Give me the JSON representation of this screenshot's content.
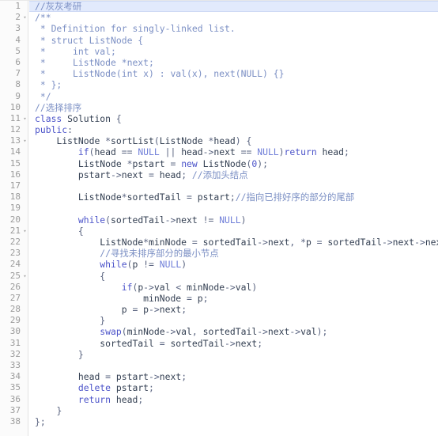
{
  "editor": {
    "name": "code-editor",
    "language": "cpp",
    "active_line": 1,
    "total_lines": 38,
    "colors": {
      "background": "#ffffff",
      "gutter_background": "#fbfbfb",
      "gutter_border": "#e3e3e3",
      "line_number": "#9a9a9a",
      "active_line_background": "#e2eafc",
      "active_line_border": "#cdd9f5",
      "plain_text": "#333f52",
      "comment": "#7b8fc4",
      "keyword": "#4b53c9",
      "constant": "#6f7ed8"
    },
    "fold_lines": [
      2,
      11,
      13,
      21,
      25
    ],
    "lines": [
      {
        "n": "1",
        "fold": false,
        "text": "//灰灰考研"
      },
      {
        "n": "2",
        "fold": true,
        "text": "/**"
      },
      {
        "n": "3",
        "fold": false,
        "text": " * Definition for singly-linked list."
      },
      {
        "n": "4",
        "fold": false,
        "text": " * struct ListNode {"
      },
      {
        "n": "5",
        "fold": false,
        "text": " *     int val;"
      },
      {
        "n": "6",
        "fold": false,
        "text": " *     ListNode *next;"
      },
      {
        "n": "7",
        "fold": false,
        "text": " *     ListNode(int x) : val(x), next(NULL) {}"
      },
      {
        "n": "8",
        "fold": false,
        "text": " * };"
      },
      {
        "n": "9",
        "fold": false,
        "text": " */"
      },
      {
        "n": "10",
        "fold": false,
        "text": "//选择排序"
      },
      {
        "n": "11",
        "fold": true,
        "text": "class Solution {"
      },
      {
        "n": "12",
        "fold": false,
        "text": "public:"
      },
      {
        "n": "13",
        "fold": true,
        "text": "    ListNode *sortList(ListNode *head) {"
      },
      {
        "n": "14",
        "fold": false,
        "text": "        if(head == NULL || head->next == NULL)return head;"
      },
      {
        "n": "15",
        "fold": false,
        "text": "        ListNode *pstart = new ListNode(0);"
      },
      {
        "n": "16",
        "fold": false,
        "text": "        pstart->next = head; //添加头结点"
      },
      {
        "n": "17",
        "fold": false,
        "text": ""
      },
      {
        "n": "18",
        "fold": false,
        "text": "        ListNode*sortedTail = pstart;//指向已排好序的部分的尾部"
      },
      {
        "n": "19",
        "fold": false,
        "text": ""
      },
      {
        "n": "20",
        "fold": false,
        "text": "        while(sortedTail->next != NULL)"
      },
      {
        "n": "21",
        "fold": true,
        "text": "        {"
      },
      {
        "n": "22",
        "fold": false,
        "text": "            ListNode*minNode = sortedTail->next, *p = sortedTail->next->next;"
      },
      {
        "n": "23",
        "fold": false,
        "text": "            //寻找未排序部分的最小节点"
      },
      {
        "n": "24",
        "fold": false,
        "text": "            while(p != NULL)"
      },
      {
        "n": "25",
        "fold": true,
        "text": "            {"
      },
      {
        "n": "26",
        "fold": false,
        "text": "                if(p->val < minNode->val)"
      },
      {
        "n": "27",
        "fold": false,
        "text": "                    minNode = p;"
      },
      {
        "n": "28",
        "fold": false,
        "text": "                p = p->next;"
      },
      {
        "n": "29",
        "fold": false,
        "text": "            }"
      },
      {
        "n": "30",
        "fold": false,
        "text": "            swap(minNode->val, sortedTail->next->val);"
      },
      {
        "n": "31",
        "fold": false,
        "text": "            sortedTail = sortedTail->next;"
      },
      {
        "n": "32",
        "fold": false,
        "text": "        }"
      },
      {
        "n": "33",
        "fold": false,
        "text": ""
      },
      {
        "n": "34",
        "fold": false,
        "text": "        head = pstart->next;"
      },
      {
        "n": "35",
        "fold": false,
        "text": "        delete pstart;"
      },
      {
        "n": "36",
        "fold": false,
        "text": "        return head;"
      },
      {
        "n": "37",
        "fold": false,
        "text": "    }"
      },
      {
        "n": "38",
        "fold": false,
        "text": "};"
      }
    ],
    "fold_marker_glyph": "▾"
  }
}
